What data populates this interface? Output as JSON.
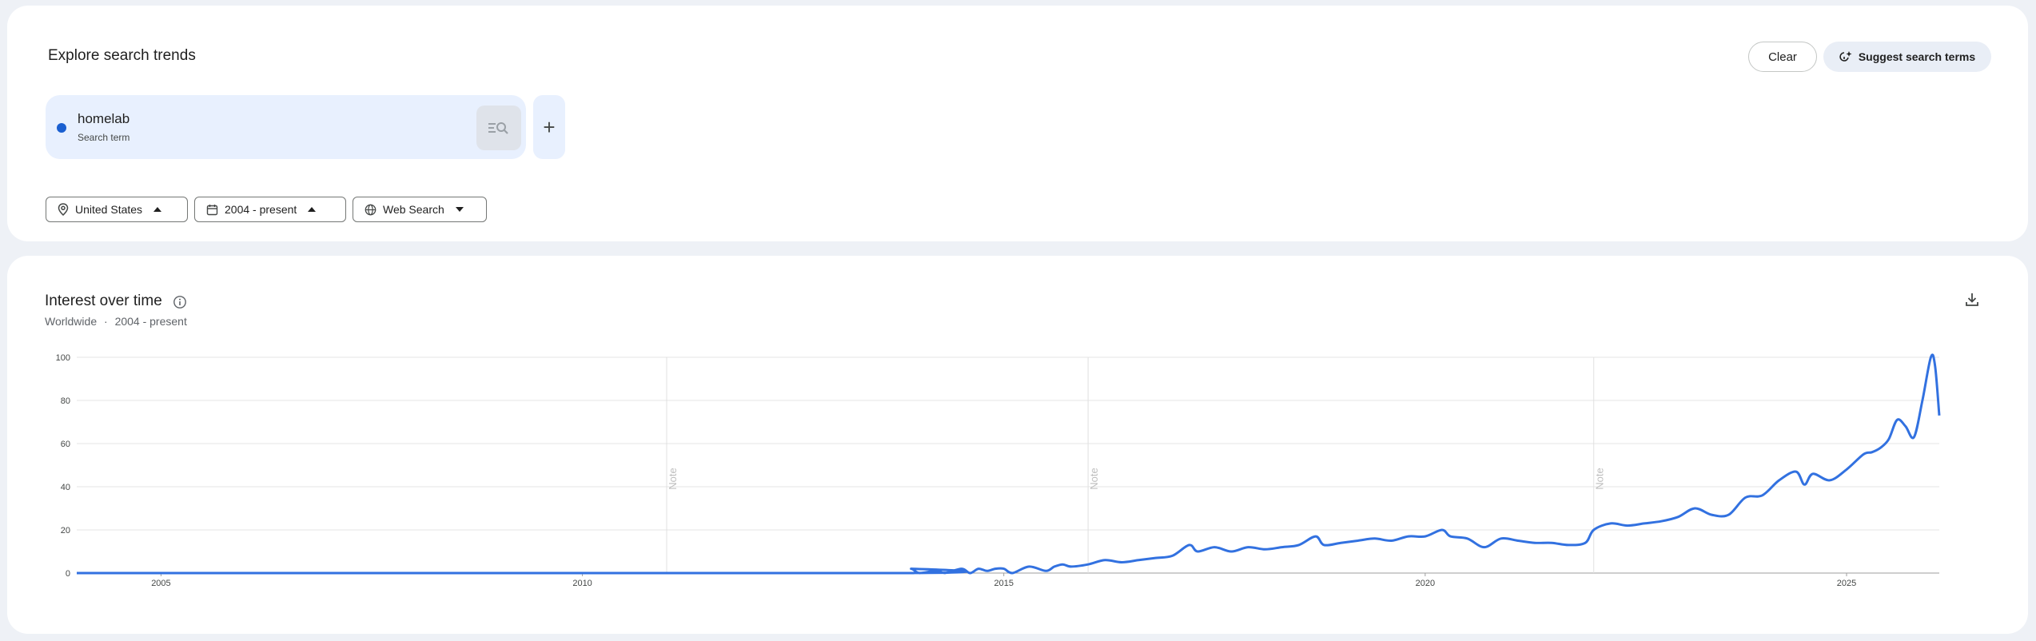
{
  "header": {
    "title": "Explore search trends"
  },
  "actions": {
    "clear_label": "Clear",
    "suggest_label": "Suggest search terms"
  },
  "term": {
    "name": "homelab",
    "type": "Search term",
    "color": "#1a5fd0"
  },
  "filters": {
    "location": "United States",
    "time_range": "2004 - present",
    "property": "Web Search"
  },
  "chart_section": {
    "title": "Interest over time",
    "subtitle_location": "Worldwide",
    "subtitle_separator": "·",
    "subtitle_range": "2004 - present",
    "note_label": "Note"
  },
  "chart_data": {
    "type": "line",
    "title": "",
    "xlabel": "",
    "ylabel": "",
    "ylim": [
      0,
      100
    ],
    "xlim": [
      2004.0,
      2026.1
    ],
    "y_ticks": [
      "0",
      "20",
      "40",
      "60",
      "80",
      "100"
    ],
    "x_ticks": [
      "2005",
      "2010",
      "2015",
      "2020",
      "2025"
    ],
    "notes_at": [
      2011.0,
      2016.0,
      2022.0
    ],
    "grid": true,
    "line_color": "#3271e0",
    "series": [
      {
        "values": [
          [
            2004.0,
            0
          ],
          [
            2013.8,
            0
          ],
          [
            2013.9,
            2
          ],
          [
            2014.0,
            0
          ],
          [
            2014.2,
            1
          ],
          [
            2014.3,
            0
          ],
          [
            2014.5,
            2
          ],
          [
            2014.6,
            0
          ],
          [
            2014.7,
            2
          ],
          [
            2014.8,
            1
          ],
          [
            2014.9,
            2
          ],
          [
            2015.0,
            2
          ],
          [
            2015.1,
            0
          ],
          [
            2015.3,
            3
          ],
          [
            2015.5,
            1
          ],
          [
            2015.6,
            3
          ],
          [
            2015.7,
            4
          ],
          [
            2015.8,
            3
          ],
          [
            2016.0,
            4
          ],
          [
            2016.2,
            6
          ],
          [
            2016.4,
            5
          ],
          [
            2016.6,
            6
          ],
          [
            2016.8,
            7
          ],
          [
            2017.0,
            8
          ],
          [
            2017.2,
            13
          ],
          [
            2017.3,
            10
          ],
          [
            2017.5,
            12
          ],
          [
            2017.7,
            10
          ],
          [
            2017.9,
            12
          ],
          [
            2018.1,
            11
          ],
          [
            2018.3,
            12
          ],
          [
            2018.5,
            13
          ],
          [
            2018.7,
            17
          ],
          [
            2018.8,
            13
          ],
          [
            2019.0,
            14
          ],
          [
            2019.2,
            15
          ],
          [
            2019.4,
            16
          ],
          [
            2019.6,
            15
          ],
          [
            2019.8,
            17
          ],
          [
            2020.0,
            17
          ],
          [
            2020.2,
            20
          ],
          [
            2020.3,
            17
          ],
          [
            2020.5,
            16
          ],
          [
            2020.7,
            12
          ],
          [
            2020.9,
            16
          ],
          [
            2021.1,
            15
          ],
          [
            2021.3,
            14
          ],
          [
            2021.5,
            14
          ],
          [
            2021.7,
            13
          ],
          [
            2021.9,
            14
          ],
          [
            2022.0,
            20
          ],
          [
            2022.2,
            23
          ],
          [
            2022.4,
            22
          ],
          [
            2022.6,
            23
          ],
          [
            2022.8,
            24
          ],
          [
            2023.0,
            26
          ],
          [
            2023.2,
            30
          ],
          [
            2023.4,
            27
          ],
          [
            2023.6,
            27
          ],
          [
            2023.8,
            35
          ],
          [
            2024.0,
            36
          ],
          [
            2024.2,
            43
          ],
          [
            2024.4,
            47
          ],
          [
            2024.5,
            41
          ],
          [
            2024.6,
            46
          ],
          [
            2024.8,
            43
          ],
          [
            2025.0,
            48
          ],
          [
            2025.2,
            55
          ],
          [
            2025.3,
            56
          ],
          [
            2025.4,
            58
          ],
          [
            2025.5,
            62
          ],
          [
            2025.6,
            71
          ],
          [
            2025.7,
            68
          ],
          [
            2025.8,
            63
          ],
          [
            2025.9,
            80
          ],
          [
            2026.0,
            100
          ],
          [
            2026.05,
            96
          ],
          [
            2026.1,
            73
          ]
        ]
      }
    ]
  }
}
